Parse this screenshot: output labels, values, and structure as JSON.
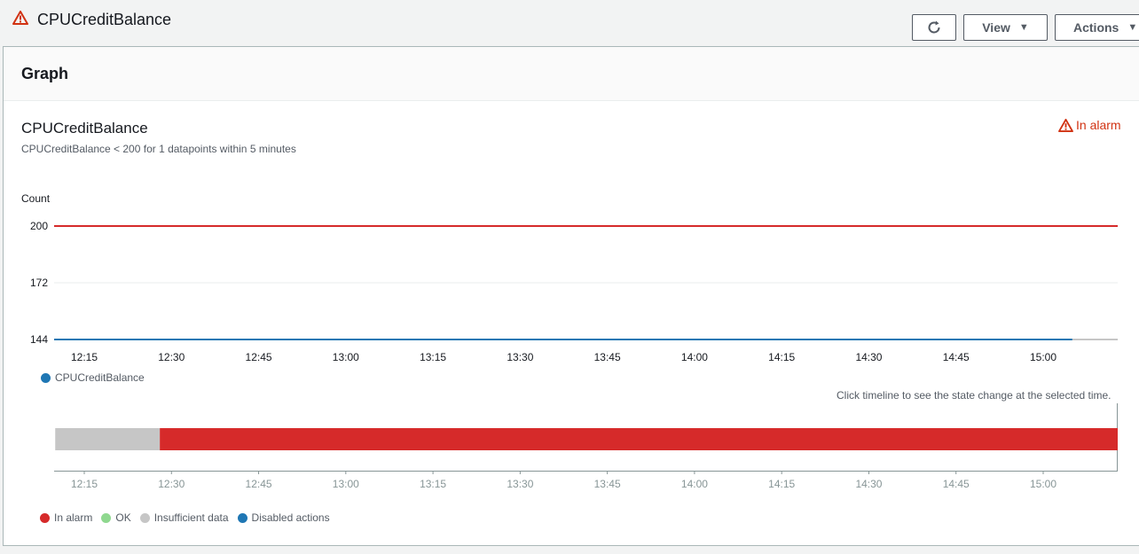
{
  "header": {
    "title": "CPUCreditBalance",
    "view_label": "View",
    "actions_label": "Actions"
  },
  "panel": {
    "heading": "Graph",
    "chart_title": "CPUCreditBalance",
    "chart_subtitle": "CPUCreditBalance < 200 for 1 datapoints within 5 minutes",
    "state_label": "In alarm",
    "timeline_hint": "Click timeline to see the state change at the selected time."
  },
  "colors": {
    "alarm": "#d62a2a",
    "ok": "#8fd88f",
    "insufficient": "#c6c6c6",
    "disabled": "#1f77b4",
    "series": "#1f77b4"
  },
  "chart_data": [
    {
      "type": "line",
      "ylabel": "Count",
      "yticks": [
        200,
        172,
        144
      ],
      "ylim": [
        144,
        200
      ],
      "x_ticks": [
        "12:15",
        "12:30",
        "12:45",
        "13:00",
        "13:15",
        "13:30",
        "13:45",
        "14:00",
        "14:15",
        "14:30",
        "14:45",
        "15:00"
      ],
      "threshold": {
        "value": 200,
        "color": "#d62a2a"
      },
      "series": [
        {
          "name": "CPUCreditBalance",
          "x_range": [
            "12:10",
            "15:05"
          ],
          "values": [
            144,
            144
          ]
        }
      ],
      "legend": "bottom-left"
    },
    {
      "type": "timeline",
      "x_ticks": [
        "12:15",
        "12:30",
        "12:45",
        "13:00",
        "13:15",
        "13:30",
        "13:45",
        "14:00",
        "14:15",
        "14:30",
        "14:45",
        "15:00"
      ],
      "segments": [
        {
          "state": "Insufficient data",
          "from": "12:10",
          "to": "12:28"
        },
        {
          "state": "In alarm",
          "from": "12:28",
          "to": "15:13"
        }
      ],
      "legend": [
        "In alarm",
        "OK",
        "Insufficient data",
        "Disabled actions"
      ]
    }
  ]
}
